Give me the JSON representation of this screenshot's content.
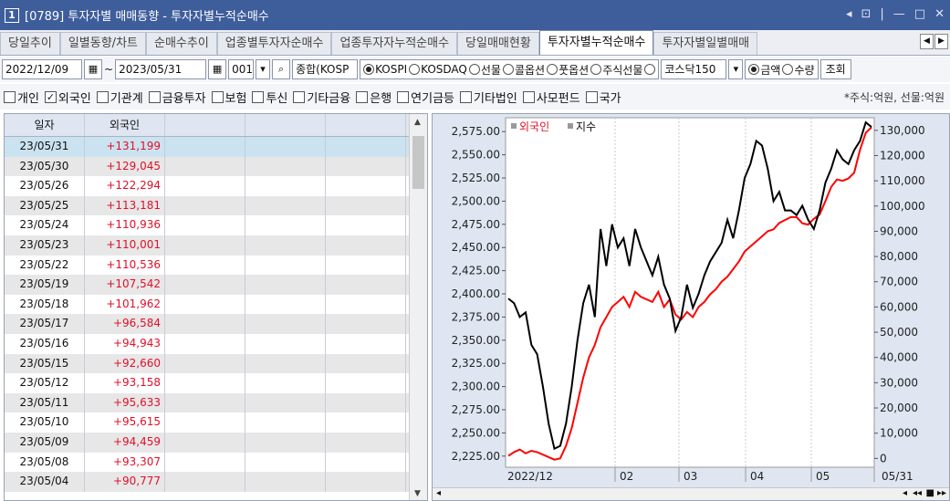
{
  "window": {
    "badge": "1",
    "title": "[0789] 투자자별 매매동향 - 투자자별누적순매수",
    "controls": [
      "◂",
      "⊡",
      "|",
      "—",
      "□",
      "✕"
    ]
  },
  "tabs": [
    "당일추이",
    "일별동향/차트",
    "순매수추이",
    "업종별투자자순매수",
    "업종투자자누적순매수",
    "당일매매현황",
    "투자자별누적순매수",
    "투자자별일별매매"
  ],
  "active_tab": 6,
  "toolbar": {
    "date_from": "2022/12/09",
    "tilde": "~",
    "date_to": "2023/05/31",
    "code": "001",
    "market_name": "종합(KOSP",
    "market_radios": [
      "KOSPI",
      "KOSDAQ",
      "선물",
      "콜옵션",
      "풋옵션",
      "주식선물"
    ],
    "index_name": "코스닥150",
    "amount_radios": [
      "금액",
      "수량"
    ],
    "query_button": "조회"
  },
  "investors": {
    "items": [
      "개인",
      "외국인",
      "기관계",
      "금융투자",
      "보험",
      "투신",
      "기타금융",
      "은행",
      "연기금등",
      "기타법인",
      "사모펀드",
      "국가"
    ],
    "checked": [
      false,
      true,
      false,
      false,
      false,
      false,
      false,
      false,
      false,
      false,
      false,
      false
    ],
    "unit_note": "*주식:억원, 선물:억원"
  },
  "table": {
    "headers": [
      "일자",
      "외국인"
    ],
    "rows": [
      [
        "23/05/31",
        "+131,199"
      ],
      [
        "23/05/30",
        "+129,045"
      ],
      [
        "23/05/26",
        "+122,294"
      ],
      [
        "23/05/25",
        "+113,181"
      ],
      [
        "23/05/24",
        "+110,936"
      ],
      [
        "23/05/23",
        "+110,001"
      ],
      [
        "23/05/22",
        "+110,536"
      ],
      [
        "23/05/19",
        "+107,542"
      ],
      [
        "23/05/18",
        "+101,962"
      ],
      [
        "23/05/17",
        "+96,584"
      ],
      [
        "23/05/16",
        "+94,943"
      ],
      [
        "23/05/15",
        "+92,660"
      ],
      [
        "23/05/12",
        "+93,158"
      ],
      [
        "23/05/11",
        "+95,633"
      ],
      [
        "23/05/10",
        "+95,615"
      ],
      [
        "23/05/09",
        "+94,459"
      ],
      [
        "23/05/08",
        "+93,307"
      ],
      [
        "23/05/04",
        "+90,777"
      ]
    ]
  },
  "chart_data": {
    "type": "line",
    "legend": [
      "외국인",
      "지수"
    ],
    "legend_position": "top-left",
    "x_labels": [
      "2022/12",
      "02",
      "03",
      "04",
      "05",
      "05/31"
    ],
    "left_axis": {
      "ticks": [
        "2,575.00",
        "2,550.00",
        "2,525.00",
        "2,500.00",
        "2,475.00",
        "2,450.00",
        "2,425.00",
        "2,400.00",
        "2,375.00",
        "2,350.00",
        "2,325.00",
        "2,300.00",
        "2,275.00",
        "2,250.00",
        "2,225.00"
      ],
      "ylim": [
        2213,
        2590
      ]
    },
    "right_axis": {
      "ticks": [
        "130,000",
        "120,000",
        "110,000",
        "100,000",
        "90,000",
        "80,000",
        "70,000",
        "60,000",
        "50,000",
        "40,000",
        "30,000",
        "20,000",
        "10,000",
        "0"
      ],
      "ylim": [
        -3500,
        135000
      ]
    },
    "grid": true,
    "series": [
      {
        "name": "외국인",
        "color": "#ff0000",
        "axis": "right",
        "values": [
          1000,
          2500,
          3500,
          2000,
          3000,
          2500,
          1500,
          500,
          -500,
          0,
          5000,
          12000,
          22000,
          32000,
          40000,
          45000,
          52000,
          56000,
          60000,
          62000,
          64000,
          60000,
          66000,
          64000,
          63000,
          62000,
          66000,
          60000,
          63000,
          57000,
          55000,
          58000,
          56000,
          60000,
          62000,
          65000,
          67000,
          70000,
          72000,
          75000,
          78000,
          82000,
          84000,
          86000,
          88000,
          90000,
          90777,
          93307,
          94459,
          95615,
          95633,
          93158,
          92660,
          94943,
          96584,
          101962,
          107542,
          110536,
          110001,
          110936,
          113181,
          122294,
          129045,
          131199
        ]
      },
      {
        "name": "지수",
        "color": "#000000",
        "axis": "left",
        "values": [
          2395,
          2390,
          2375,
          2380,
          2345,
          2335,
          2300,
          2260,
          2233,
          2236,
          2260,
          2300,
          2350,
          2390,
          2410,
          2375,
          2470,
          2430,
          2475,
          2450,
          2460,
          2430,
          2470,
          2450,
          2435,
          2420,
          2440,
          2410,
          2395,
          2360,
          2375,
          2410,
          2385,
          2400,
          2420,
          2435,
          2445,
          2455,
          2480,
          2460,
          2490,
          2525,
          2540,
          2565,
          2560,
          2535,
          2500,
          2510,
          2490,
          2490,
          2485,
          2495,
          2480,
          2470,
          2490,
          2520,
          2535,
          2555,
          2545,
          2540,
          2555,
          2565,
          2585,
          2580
        ]
      }
    ]
  }
}
